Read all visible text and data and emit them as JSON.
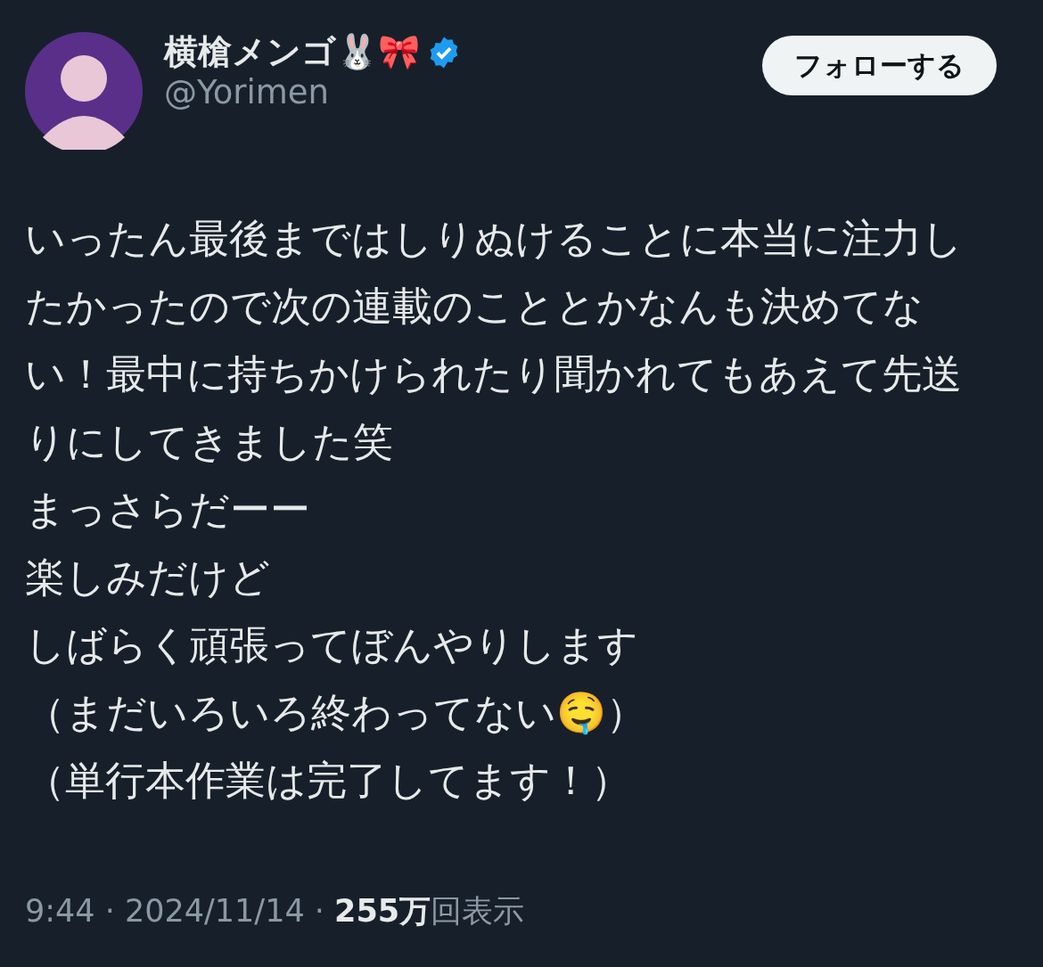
{
  "author": {
    "name": "横槍メンゴ🐰🎀",
    "verified": true,
    "handle": "@Yorimen"
  },
  "follow_button": {
    "label": "フォローする"
  },
  "post": {
    "paragraphs": [
      "いったん最後まではしりぬけることに本当に注力したかったので次の連載のこととかなんも決めてない！最中に持ちかけられたり聞かれてもあえて先送りにしてきました笑",
      "まっさらだーー",
      "楽しみだけど",
      "しばらく頑張ってぼんやりします",
      "（まだいろいろ終わってない🤤）",
      "（単行本作業は完了してます！）"
    ]
  },
  "meta": {
    "text": "9:44 · 2024/11/14 · **255万**回表示"
  }
}
